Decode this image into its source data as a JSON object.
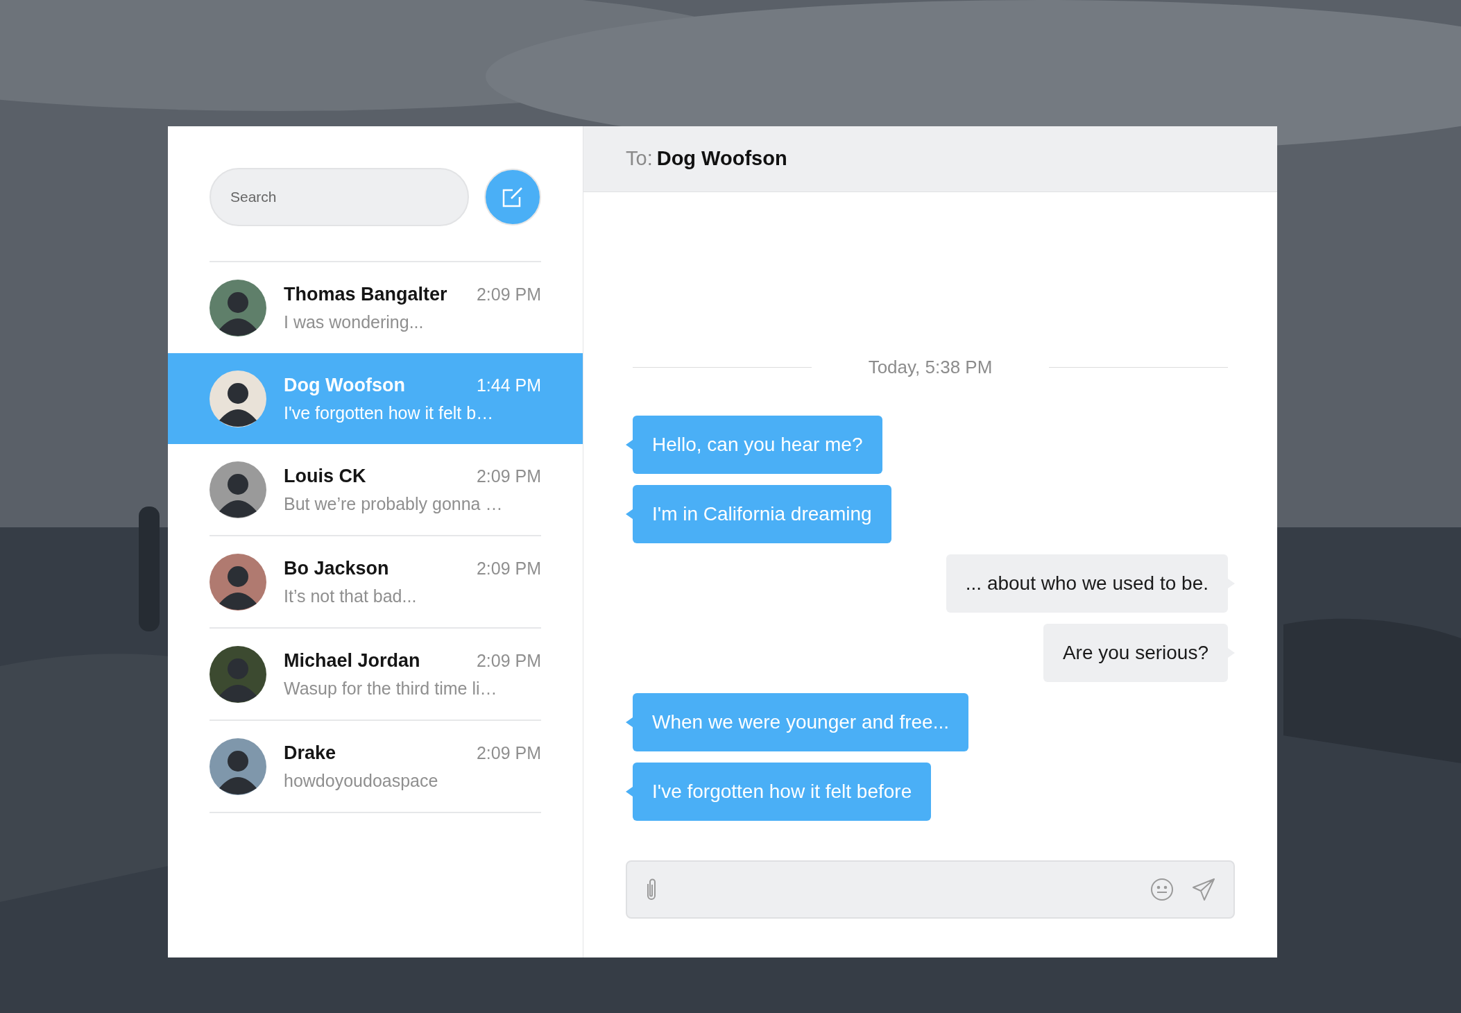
{
  "sidebar": {
    "search": {
      "placeholder": "Search"
    },
    "conversations": [
      {
        "name": "Thomas Bangalter",
        "time": "2:09 PM",
        "preview": "I was wondering...",
        "selected": false
      },
      {
        "name": "Dog Woofson",
        "time": "1:44 PM",
        "preview": "I've forgotten how it felt b…",
        "selected": true
      },
      {
        "name": "Louis CK",
        "time": "2:09 PM",
        "preview": "But we’re probably gonna …",
        "selected": false
      },
      {
        "name": "Bo Jackson",
        "time": "2:09 PM",
        "preview": "It’s not that bad...",
        "selected": false
      },
      {
        "name": "Michael Jordan",
        "time": "2:09 PM",
        "preview": "Wasup for the third time li…",
        "selected": false
      },
      {
        "name": "Drake",
        "time": "2:09 PM",
        "preview": "howdoyoudoaspace",
        "selected": false
      }
    ]
  },
  "chat": {
    "to_label": "To:",
    "recipient": "Dog Woofson",
    "date": "Today, 5:38 PM",
    "messages": [
      {
        "kind": "incoming",
        "text": "Hello, can you hear me?"
      },
      {
        "kind": "incoming",
        "text": "I'm in California dreaming"
      },
      {
        "kind": "outgoing",
        "text": "... about who we used to be."
      },
      {
        "kind": "outgoing",
        "text": "Are you serious?"
      },
      {
        "kind": "incoming",
        "text": "When we were younger and free..."
      },
      {
        "kind": "incoming",
        "text": "I've forgotten how it felt before"
      }
    ]
  }
}
